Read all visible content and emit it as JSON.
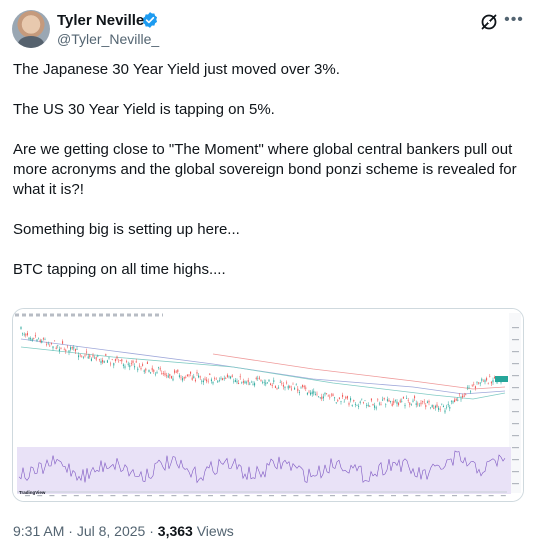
{
  "author": {
    "name": "Tyler Neville",
    "handle": "@Tyler_Neville_"
  },
  "tweet": {
    "lines": [
      "The Japanese 30 Year Yield just moved over 3%.",
      "The US 30 Year Yield is tapping on 5%.",
      "Are we getting close to \"The Moment\" where global central bankers pull out more acronyms and the global sovereign bond ponzi scheme is revealed for what it is?!",
      "Something big is setting up here...",
      "BTC tapping on all time highs...."
    ]
  },
  "media": {
    "watermark": "TradingView"
  },
  "footer": {
    "time": "9:31 AM",
    "date": "Jul 8, 2025",
    "views_count": "3,363",
    "views_label": "Views"
  },
  "colors": {
    "accent": "#1d9bf0",
    "text": "#0f1419",
    "muted": "#536471",
    "price_up": "#26a69a",
    "price_down": "#ef5350",
    "rsi_band": "#e9e2f7"
  },
  "icons": [
    "verified-badge-icon",
    "grok-icon",
    "more-icon"
  ]
}
